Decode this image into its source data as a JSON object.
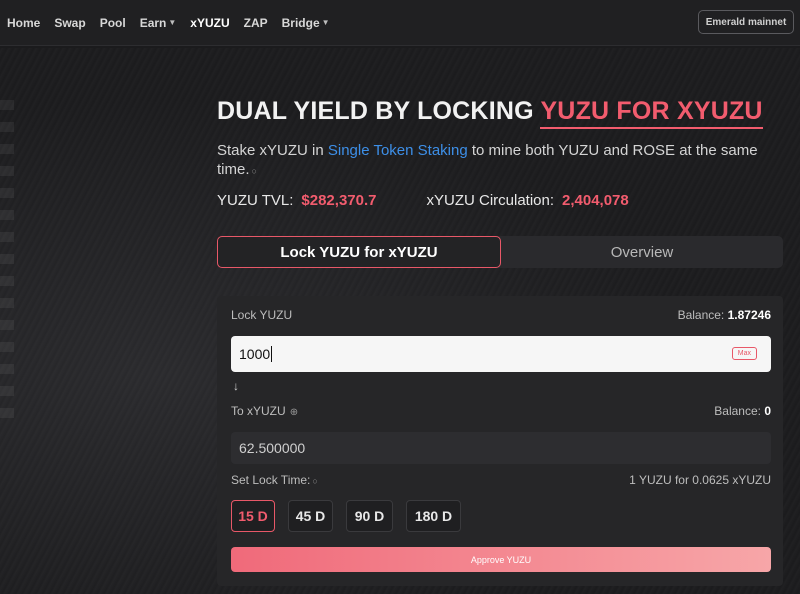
{
  "nav": {
    "items": [
      {
        "label": "Home",
        "dropdown": false,
        "active": false
      },
      {
        "label": "Swap",
        "dropdown": false,
        "active": false
      },
      {
        "label": "Pool",
        "dropdown": false,
        "active": false
      },
      {
        "label": "Earn",
        "dropdown": true,
        "active": false
      },
      {
        "label": "xYUZU",
        "dropdown": false,
        "active": true
      },
      {
        "label": "ZAP",
        "dropdown": false,
        "active": false
      },
      {
        "label": "Bridge",
        "dropdown": true,
        "active": false
      }
    ],
    "network": "Emerald mainnet"
  },
  "hero": {
    "title_prefix": "DUAL YIELD BY LOCKING ",
    "title_highlight": "YUZU FOR XYUZU",
    "subtitle_pre": "Stake xYUZU in ",
    "subtitle_link": "Single Token Staking",
    "subtitle_post": " to mine both YUZU and ROSE at the same time."
  },
  "stats": {
    "tvl_label": "YUZU TVL:",
    "tvl_value": "$282,370.7",
    "circ_label": "xYUZU Circulation:",
    "circ_value": "2,404,078"
  },
  "tabs": [
    "Lock YUZU for xYUZU",
    "Overview"
  ],
  "lock": {
    "label": "Lock YUZU",
    "balance_label": "Balance:",
    "balance_value": "1.87246",
    "input_value": "1000",
    "max_label": "Max"
  },
  "receive": {
    "label": "To xYUZU",
    "balance_label": "Balance:",
    "balance_value": "0",
    "output_value": "62.500000"
  },
  "lock_time": {
    "label": "Set Lock Time:",
    "rate": "1 YUZU for 0.0625 xYUZU",
    "options": [
      "15 D",
      "45 D",
      "90 D",
      "180 D"
    ],
    "selected": "15 D"
  },
  "approve_label": "Approve YUZU",
  "colors": {
    "accent": "#f25c6e",
    "link": "#3d8fe8",
    "background": "#1b1b1d"
  },
  "icons": {
    "dropdown": "chevron-down-icon",
    "info": "info-icon",
    "arrow": "arrow-down-icon",
    "plus": "plus-circle-icon"
  }
}
